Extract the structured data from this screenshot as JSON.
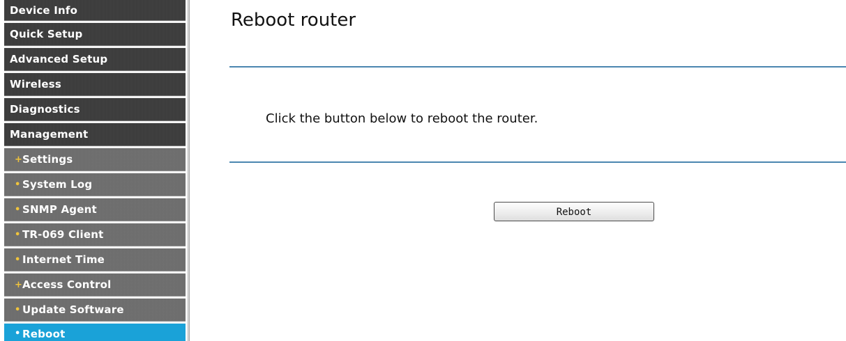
{
  "page": {
    "title": "Reboot router",
    "instruction": "Click the button below to reboot the router.",
    "reboot_label": "Reboot"
  },
  "menu": {
    "top_items": [
      {
        "label": "Device Info"
      },
      {
        "label": "Quick Setup"
      },
      {
        "label": "Advanced Setup"
      },
      {
        "label": "Wireless"
      },
      {
        "label": "Diagnostics"
      },
      {
        "label": "Management"
      }
    ],
    "sub_items": [
      {
        "label": "Settings",
        "bullet": "+"
      },
      {
        "label": "System Log",
        "bullet": "•"
      },
      {
        "label": "SNMP Agent",
        "bullet": "•"
      },
      {
        "label": "TR-069 Client",
        "bullet": "•"
      },
      {
        "label": "Internet Time",
        "bullet": "•"
      },
      {
        "label": "Access Control",
        "bullet": "+"
      },
      {
        "label": "Update Software",
        "bullet": "•"
      },
      {
        "label": "Reboot",
        "bullet": "•",
        "active": true
      }
    ]
  },
  "colors": {
    "menu_dark": "#3a3a3a",
    "menu_sub": "#6b6b6b",
    "active": "#1aa2d8",
    "bullet": "#f0c43c",
    "rule": "#4a86b0"
  }
}
